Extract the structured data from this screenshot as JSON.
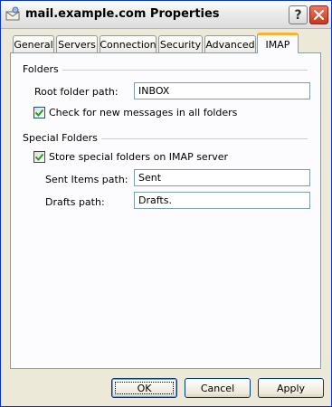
{
  "window": {
    "title": "mail.example.com Properties",
    "help_label": "?",
    "close_label": "✕"
  },
  "tabs": [
    {
      "label": "General"
    },
    {
      "label": "Servers"
    },
    {
      "label": "Connection"
    },
    {
      "label": "Security"
    },
    {
      "label": "Advanced"
    },
    {
      "label": "IMAP",
      "active": true
    }
  ],
  "folders": {
    "group_label": "Folders",
    "root_path_label": "Root folder path:",
    "root_path_value": "INBOX",
    "check_all_label": "Check for new messages in all folders",
    "check_all_checked": true
  },
  "special_folders": {
    "group_label": "Special Folders",
    "store_label": "Store special folders on IMAP server",
    "store_checked": true,
    "sent_label": "Sent Items path:",
    "sent_value": "Sent",
    "drafts_label": "Drafts path:",
    "drafts_value": "Drafts."
  },
  "buttons": {
    "ok": "OK",
    "cancel": "Cancel",
    "apply": "Apply"
  },
  "colors": {
    "accent_tab": "#f9b139",
    "checkmark": "#21a121",
    "window_bg": "#ece9d8"
  }
}
